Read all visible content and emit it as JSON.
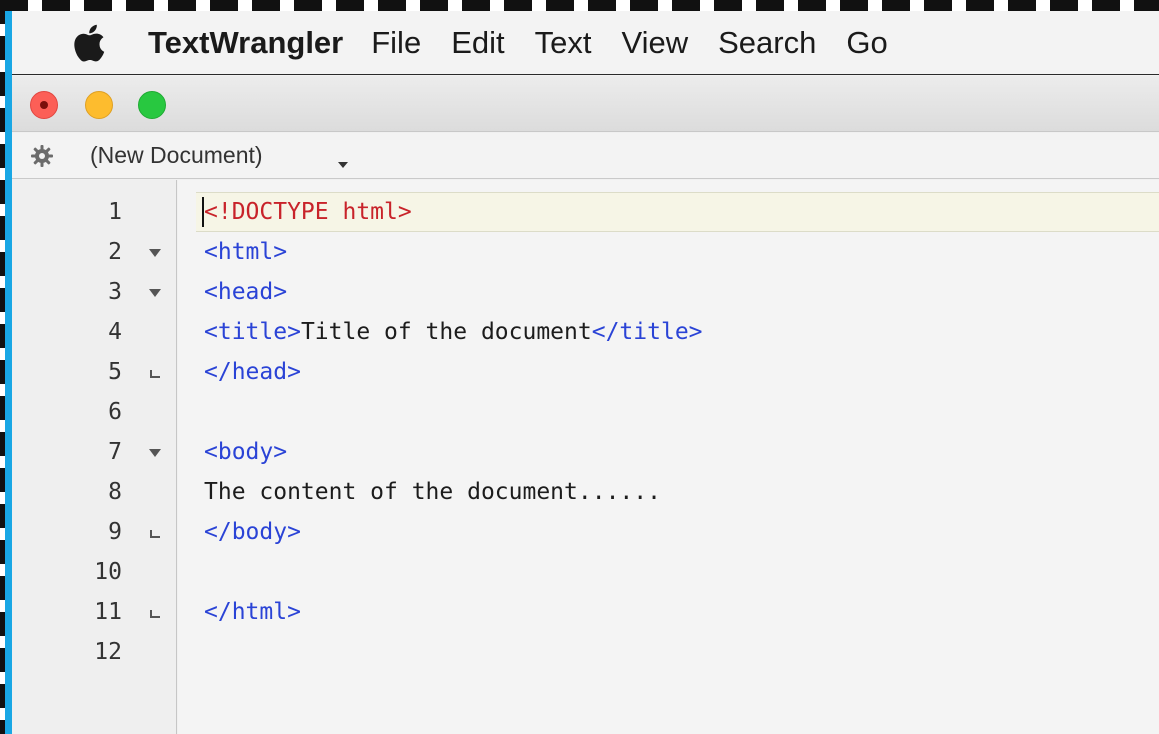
{
  "menubar": {
    "apple_icon": "apple-logo-icon",
    "app_name": "TextWrangler",
    "items": [
      "File",
      "Edit",
      "Text",
      "View",
      "Search",
      "Go"
    ]
  },
  "window": {
    "traffic_lights": [
      "close",
      "minimize",
      "zoom"
    ],
    "document_title": "(New Document)",
    "gear_icon": "gear-icon"
  },
  "editor": {
    "line_numbers": [
      "1",
      "2",
      "3",
      "4",
      "5",
      "6",
      "7",
      "8",
      "9",
      "10",
      "11",
      "12"
    ],
    "fold_markers": [
      "",
      "open",
      "open",
      "",
      "close",
      "",
      "open",
      "",
      "close",
      "",
      "close",
      ""
    ],
    "lines": [
      [
        {
          "text": "<!DOCTYPE html>",
          "kind": "doctype"
        }
      ],
      [
        {
          "text": "<html>",
          "kind": "tag"
        }
      ],
      [
        {
          "text": "<head>",
          "kind": "tag"
        }
      ],
      [
        {
          "text": "<title>",
          "kind": "tag"
        },
        {
          "text": "Title of the document",
          "kind": "text"
        },
        {
          "text": "</title>",
          "kind": "tag"
        }
      ],
      [
        {
          "text": "</head>",
          "kind": "tag"
        }
      ],
      [],
      [
        {
          "text": "<body>",
          "kind": "tag"
        }
      ],
      [
        {
          "text": "The content of the document......",
          "kind": "text"
        }
      ],
      [
        {
          "text": "</body>",
          "kind": "tag"
        }
      ],
      [],
      [
        {
          "text": "</html>",
          "kind": "tag"
        }
      ],
      []
    ]
  },
  "colors": {
    "doctype": "#c8232a",
    "tag": "#2a43d6",
    "text": "#1c1c1c",
    "frame_accent": "#19a7e5"
  }
}
